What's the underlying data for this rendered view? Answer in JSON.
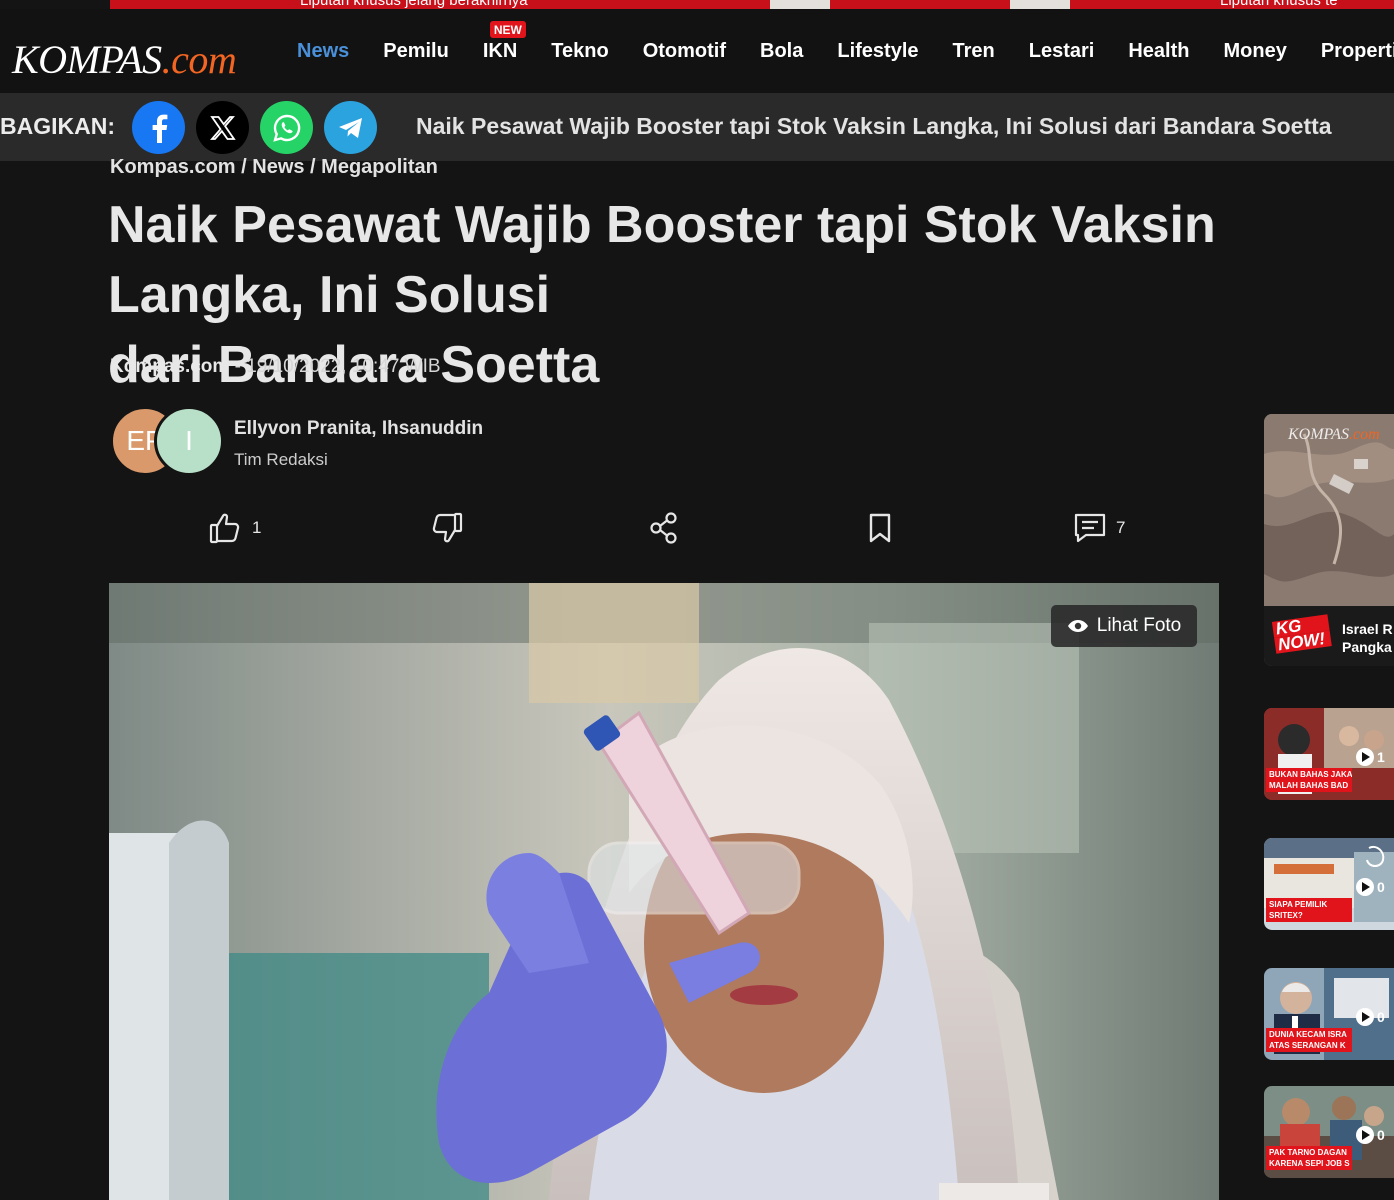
{
  "promo": {
    "text_left": "Liputan khusus jelang berakhirnya",
    "text_right": "Liputan khusus te"
  },
  "brand": {
    "logo_main": "KOMPAS",
    "logo_suffix": ".com"
  },
  "nav": {
    "items": [
      {
        "label": "News",
        "active": true
      },
      {
        "label": "Pemilu"
      },
      {
        "label": "IKN",
        "badge": "NEW"
      },
      {
        "label": "Tekno"
      },
      {
        "label": "Otomotif"
      },
      {
        "label": "Bola"
      },
      {
        "label": "Lifestyle"
      },
      {
        "label": "Tren"
      },
      {
        "label": "Lestari"
      },
      {
        "label": "Health"
      },
      {
        "label": "Money"
      },
      {
        "label": "Properti"
      }
    ]
  },
  "share": {
    "label": "BAGIKAN:",
    "title": "Naik Pesawat Wajib Booster tapi Stok Vaksin Langka, Ini Solusi dari Bandara Soetta"
  },
  "article": {
    "breadcrumb": "Kompas.com / News / Megapolitan",
    "headline_line1": "Naik Pesawat Wajib Booster tapi Stok Vaksin Langka, Ini Solusi",
    "headline_line2": "dari Bandara Soetta",
    "source": "Kompas.com",
    "date": " - 19/10/2022, 10:47 WIB",
    "avatar1": "EP",
    "avatar2": "I",
    "authors": "Ellyvon Pranita, Ihsanuddin",
    "team": "Tim Redaksi",
    "like_count": "1",
    "comment_count": "7",
    "photo_button": "Lihat Foto"
  },
  "rail": {
    "featured_watermark_main": "KOMPAS",
    "featured_watermark_suffix": ".com",
    "featured_badge_top": "KG",
    "featured_badge_bottom": "NOW!",
    "featured_title_l1": "Israel R",
    "featured_title_l2": "Pangka",
    "videos": [
      {
        "caption_l1": "BUKAN BAHAS JAKA",
        "caption_l2": "MALAH BAHAS BAD",
        "duration": "1"
      },
      {
        "caption_l1": "SIAPA PEMILIK",
        "caption_l2": "SRITEX?",
        "duration": "0"
      },
      {
        "caption_l1": "DUNIA KECAM ISRA",
        "caption_l2": "ATAS SERANGAN K",
        "duration": "0"
      },
      {
        "caption_l1": "PAK TARNO DAGAN",
        "caption_l2": "KARENA SEPI JOB S",
        "duration": "0"
      }
    ]
  },
  "colors": {
    "accent": "#4a90d9",
    "brand_orange": "#f26522",
    "badge_red": "#e1141b",
    "page_bg": "#141414"
  }
}
